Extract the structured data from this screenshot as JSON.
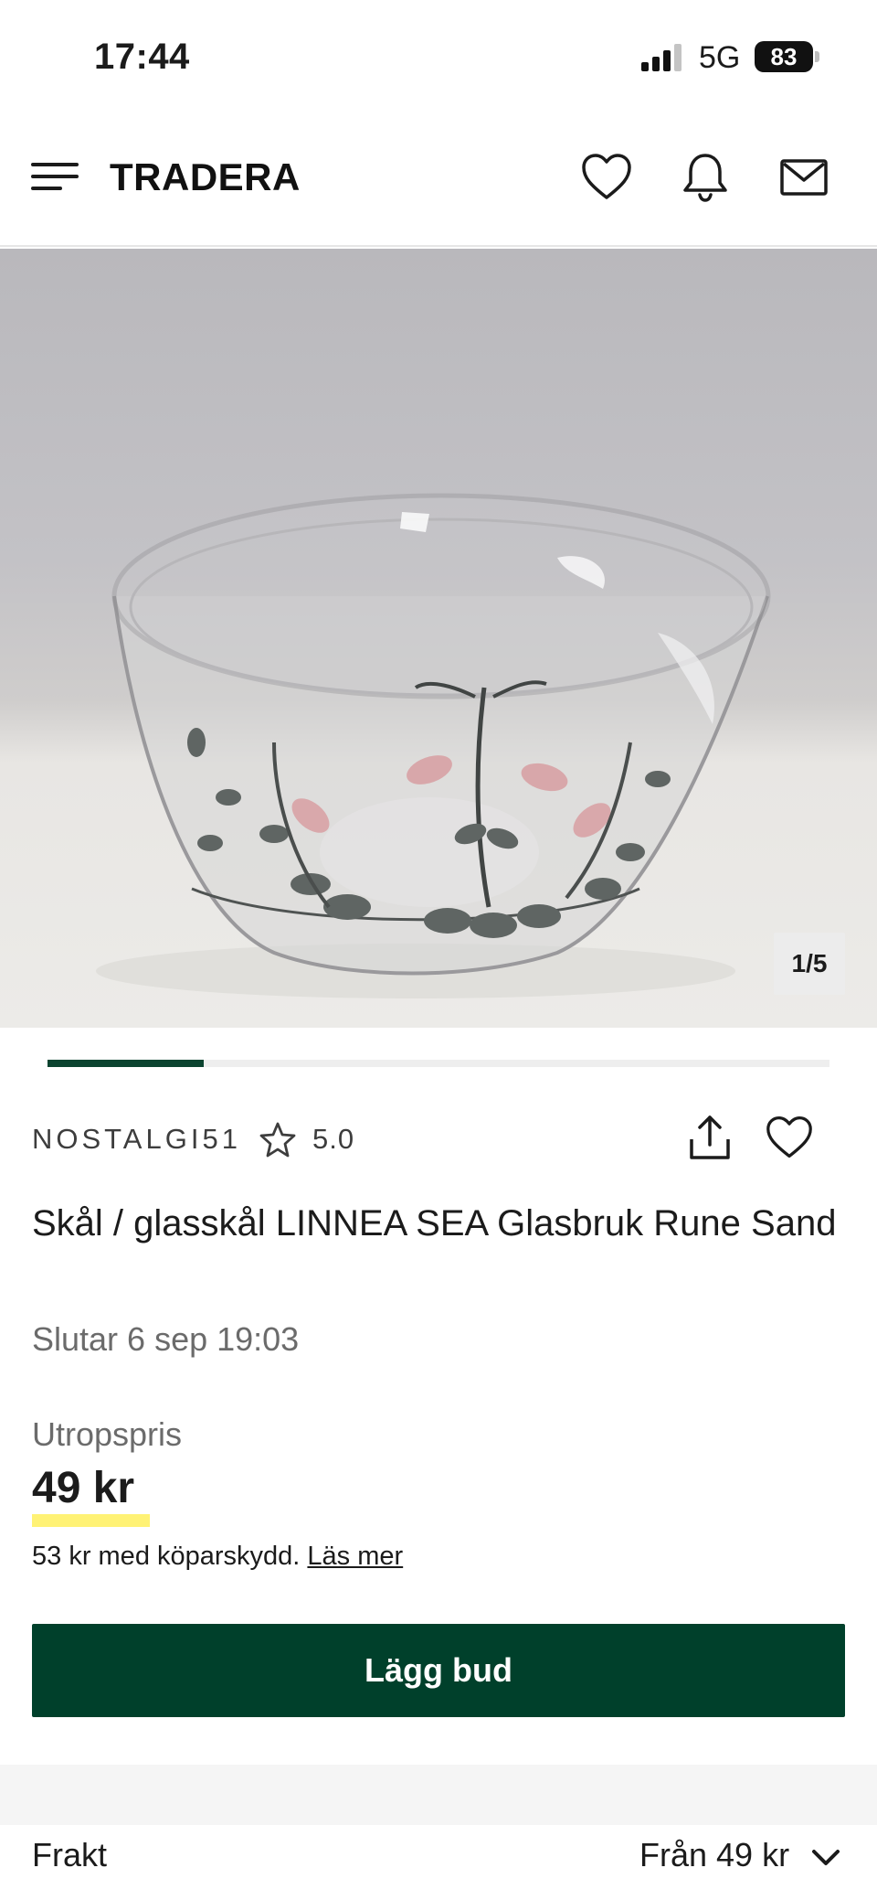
{
  "status_bar": {
    "time": "17:44",
    "network": "5G",
    "battery": "83"
  },
  "header": {
    "logo": "TRADERA",
    "icons": [
      "menu-icon",
      "heart-icon",
      "bell-icon",
      "mail-icon"
    ]
  },
  "gallery": {
    "counter": "1/5",
    "progress": 0.2
  },
  "listing": {
    "seller": "NOSTALGI51",
    "rating": "5.0",
    "title": "Skål / glasskål LINNEA SEA Glasbruk Rune Sand",
    "ends": "Slutar 6 sep 19:03",
    "price_label": "Utropspris",
    "price": "49 kr",
    "protection_text": "53 kr med köparskydd.",
    "protection_link": "Läs mer",
    "bid_button": "Lägg bud"
  },
  "shipping": {
    "label": "Frakt",
    "value": "Från 49 kr"
  },
  "colors": {
    "brand_green": "#00402b",
    "price_highlight": "#fff275"
  }
}
